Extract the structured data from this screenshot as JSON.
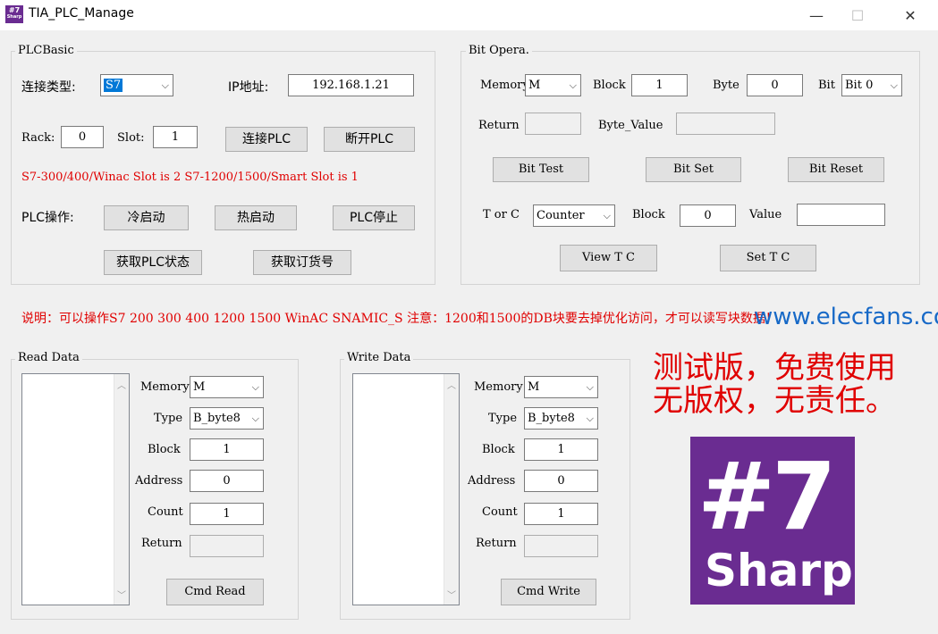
{
  "window": {
    "title": "TIA_PLC_Manage",
    "icon_text_top": "#7",
    "icon_text_bottom": "Sharp",
    "min": "—",
    "max": "☐",
    "close": "✕"
  },
  "plc_basic": {
    "label": "PLCBasic",
    "conn_type_label": "连接类型:",
    "conn_type_value": "S7",
    "ip_label": "IP地址:",
    "ip_value": "192.168.1.21",
    "rack_label": "Rack:",
    "rack_value": "0",
    "slot_label": "Slot:",
    "slot_value": "1",
    "connect_btn": "连接PLC",
    "disconnect_btn": "断开PLC",
    "slot_hint": "S7-300/400/Winac Slot is 2  S7-1200/1500/Smart Slot is 1",
    "op_label": "PLC操作:",
    "cold_start_btn": "冷启动",
    "warm_start_btn": "热启动",
    "stop_btn": "PLC停止",
    "status_btn": "获取PLC状态",
    "order_btn": "获取订货号"
  },
  "bit_opera": {
    "label": "Bit Opera.",
    "memory_label": "Memory",
    "memory_value": "M",
    "block_label": "Block",
    "block_value": "1",
    "byte_label": "Byte",
    "byte_value": "0",
    "bit_label": "Bit",
    "bit_value": "Bit 0",
    "return_label": "Return",
    "return_value": "",
    "byte_value_label": "Byte_Value",
    "byte_value_value": "",
    "bit_test_btn": "Bit Test",
    "bit_set_btn": "Bit Set",
    "bit_reset_btn": "Bit Reset",
    "torc_label": "T or C",
    "torc_value": "Counter",
    "block2_label": "Block",
    "block2_value": "0",
    "value_label": "Value",
    "value_value": "",
    "view_tc_btn": "View T C",
    "set_tc_btn": "Set T C"
  },
  "notice": "说明：可以操作S7 200 300 400 1200 1500 WinAC SNAMIC_S  注意：1200和1500的DB块要去掉优化访问，才可以读写块数据！",
  "watermark": "www.elecfans.com",
  "read_data": {
    "label": "Read Data",
    "memory_label": "Memory",
    "memory_value": "M",
    "type_label": "Type",
    "type_value": "B_byte8",
    "block_label": "Block",
    "block_value": "1",
    "address_label": "Address",
    "address_value": "0",
    "count_label": "Count",
    "count_value": "1",
    "return_label": "Return",
    "return_value": "",
    "cmd_btn": "Cmd Read"
  },
  "write_data": {
    "label": "Write Data",
    "memory_label": "Memory",
    "memory_value": "M",
    "type_label": "Type",
    "type_value": "B_byte8",
    "block_label": "Block",
    "block_value": "1",
    "address_label": "Address",
    "address_value": "0",
    "count_label": "Count",
    "count_value": "1",
    "return_label": "Return",
    "return_value": "",
    "cmd_btn": "Cmd Write"
  },
  "promo": {
    "line1": "测试版，免费使用",
    "line2": "无版权，无责任。"
  },
  "logo": {
    "line1": "#7",
    "line2": "Sharp"
  },
  "icons": {
    "dropdown": "chevron-down-icon",
    "scroll_up": "chevron-up-icon",
    "scroll_down": "chevron-down-icon"
  },
  "colors": {
    "notice_red": "#e00000",
    "logo_purple": "#6a2c91",
    "select_highlight": "#0078d7"
  }
}
